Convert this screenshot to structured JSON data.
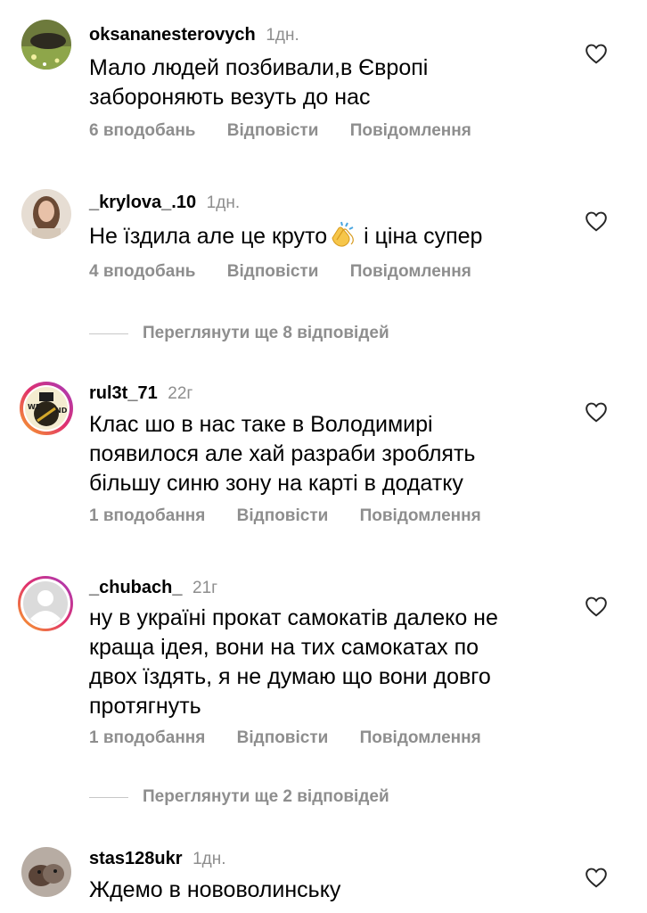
{
  "comments": [
    {
      "username": "oksananesterovych",
      "time": "1дн.",
      "text_lines": [
        "Мало людей позбивали,в Європі",
        "забороняють везуть до нас"
      ],
      "likes": "6 вподобань",
      "reply": "Відповісти",
      "report": "Повідомлення"
    },
    {
      "username": "_krylova_.10",
      "time": "1дн.",
      "text_before": "Не їздила але це круто",
      "emoji": "clapping-hands",
      "text_after": " і ціна супер",
      "likes": "4 вподобань",
      "reply": "Відповісти",
      "report": "Повідомлення"
    },
    {
      "username": "rul3t_71",
      "time": "22г",
      "text_lines": [
        "Клас шо в нас таке в Володимирі",
        "появилося але хай разраби зроблять",
        "більшу синю зону на карті в додатку"
      ],
      "likes": "1 вподобання",
      "reply": "Відповісти",
      "report": "Повідомлення"
    },
    {
      "username": "_chubach_",
      "time": "21г",
      "text_lines": [
        "ну в україні прокат самокатів далеко не",
        "краща ідея, вони на тих самокатах по",
        "двох їздять, я не думаю що вони довго",
        "протягнуть"
      ],
      "likes": "1 вподобання",
      "reply": "Відповісти",
      "report": "Повідомлення"
    },
    {
      "username": "stas128ukr",
      "time": "1дн.",
      "text_lines": [
        "Ждемо в нововолинську"
      ]
    }
  ],
  "view_replies": [
    "Переглянути ще 8 відповідей",
    "Переглянути ще 2 відповідей"
  ],
  "icons": {
    "like": "heart-outline-icon"
  },
  "colors": {
    "secondary_text": "#8e8e8e",
    "story_ring_start": "#f9a825",
    "story_ring_end": "#d62976"
  }
}
